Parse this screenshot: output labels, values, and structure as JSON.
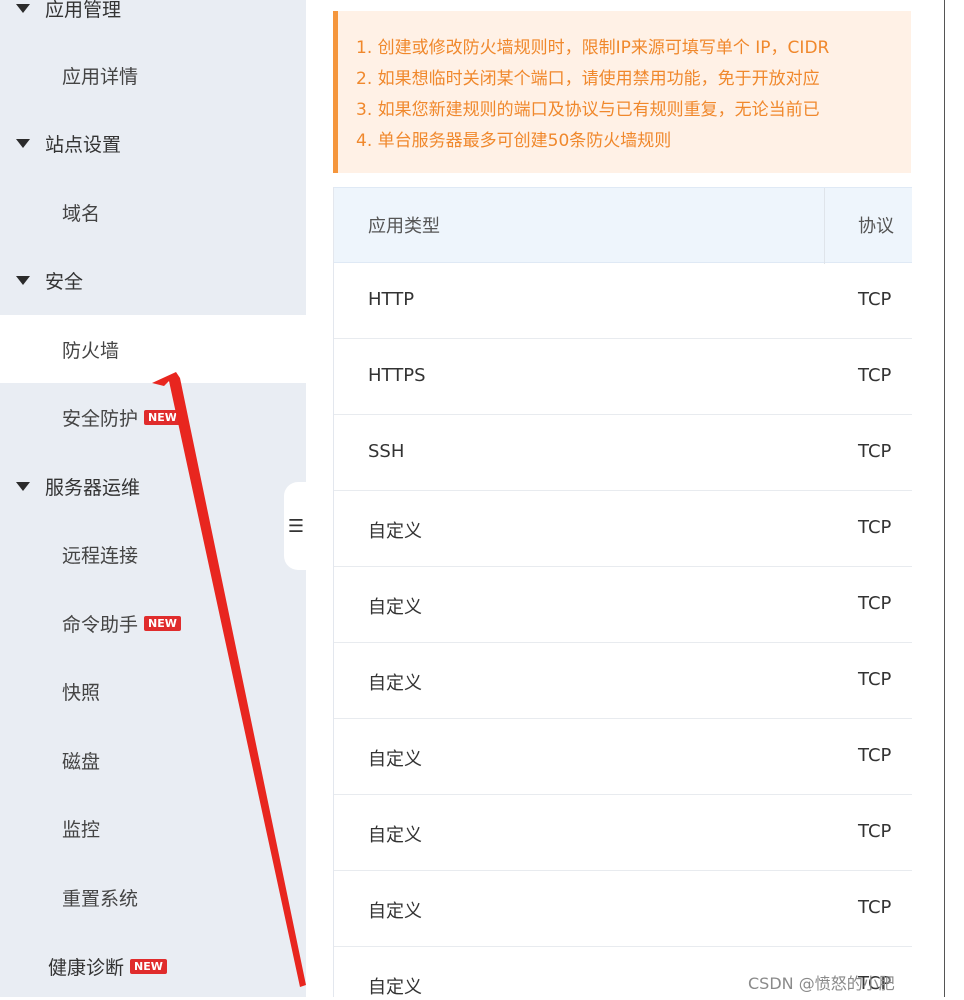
{
  "sidebar": {
    "items": [
      {
        "label": "应用管理",
        "type": "group"
      },
      {
        "label": "应用详情",
        "type": "sub"
      },
      {
        "label": "站点设置",
        "type": "group"
      },
      {
        "label": "域名",
        "type": "sub"
      },
      {
        "label": "安全",
        "type": "group"
      },
      {
        "label": "防火墙",
        "type": "sub",
        "active": true
      },
      {
        "label": "安全防护",
        "type": "sub",
        "badge": "NEW"
      },
      {
        "label": "服务器运维",
        "type": "group"
      },
      {
        "label": "远程连接",
        "type": "sub"
      },
      {
        "label": "命令助手",
        "type": "sub",
        "badge": "NEW"
      },
      {
        "label": "快照",
        "type": "sub"
      },
      {
        "label": "磁盘",
        "type": "sub"
      },
      {
        "label": "监控",
        "type": "sub"
      },
      {
        "label": "重置系统",
        "type": "sub"
      },
      {
        "label": "健康诊断",
        "type": "plain",
        "badge": "NEW"
      }
    ],
    "collapse_icon": "list-collapse-icon"
  },
  "notice": {
    "lines": [
      "1. 创建或修改防火墙规则时，限制IP来源可填写单个 IP，CIDR",
      "2. 如果想临时关闭某个端口，请使用禁用功能，免于开放对应",
      "3. 如果您新建规则的端口及协议与已有规则重复，无论当前已",
      "4. 单台服务器最多可创建50条防火墙规则"
    ],
    "color": "#f0882c"
  },
  "table": {
    "headers": {
      "type": "应用类型",
      "protocol": "协议"
    },
    "rows": [
      {
        "type": "HTTP",
        "protocol": "TCP"
      },
      {
        "type": "HTTPS",
        "protocol": "TCP"
      },
      {
        "type": "SSH",
        "protocol": "TCP"
      },
      {
        "type": "自定义",
        "protocol": "TCP"
      },
      {
        "type": "自定义",
        "protocol": "TCP"
      },
      {
        "type": "自定义",
        "protocol": "TCP"
      },
      {
        "type": "自定义",
        "protocol": "TCP"
      },
      {
        "type": "自定义",
        "protocol": "TCP"
      },
      {
        "type": "自定义",
        "protocol": "TCP"
      },
      {
        "type": "自定义",
        "protocol": "TCP"
      }
    ]
  },
  "annotation": {
    "arrow_color": "#e8261f"
  },
  "watermark": "CSDN @愤怒的小肥"
}
